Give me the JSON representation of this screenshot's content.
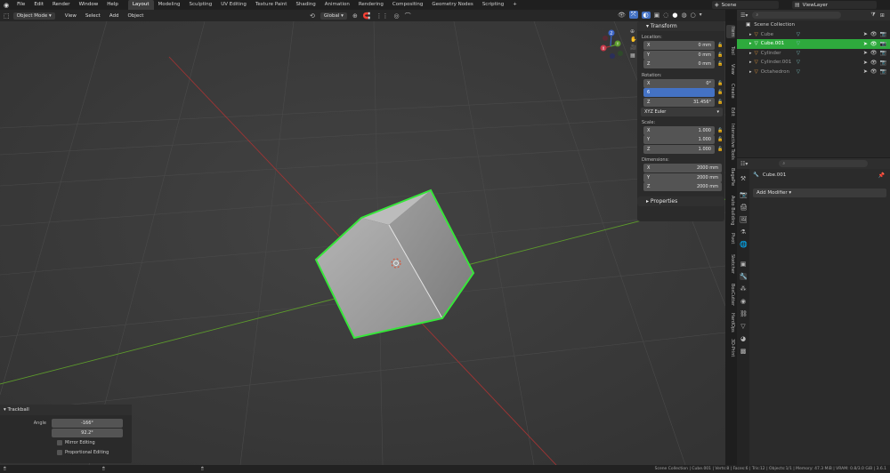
{
  "topbar": {
    "menus": [
      "File",
      "Edit",
      "Render",
      "Window",
      "Help"
    ],
    "workspaces": [
      "Layout",
      "Modeling",
      "Sculpting",
      "UV Editing",
      "Texture Paint",
      "Shading",
      "Animation",
      "Rendering",
      "Compositing",
      "Geometry Nodes",
      "Scripting"
    ],
    "add_tab": "+",
    "scene_label": "Scene",
    "viewlayer_label": "ViewLayer"
  },
  "viewport_header": {
    "mode": "Object Mode",
    "menus": [
      "View",
      "Select",
      "Add",
      "Object"
    ],
    "orientation": "Global"
  },
  "gizmo": {
    "x": "X",
    "y": "Y",
    "z": "Z"
  },
  "npanel": {
    "transform_title": "Transform",
    "location_label": "Location:",
    "location": [
      {
        "axis": "X",
        "value": "0 mm"
      },
      {
        "axis": "Y",
        "value": "0 mm"
      },
      {
        "axis": "Z",
        "value": "0 mm"
      }
    ],
    "rotation_label": "Rotation:",
    "rotation": [
      {
        "axis": "X",
        "value": "0°"
      },
      {
        "axis": "",
        "value": "6"
      },
      {
        "axis": "Z",
        "value": "31.456°"
      }
    ],
    "rotation_mode": "XYZ Euler",
    "scale_label": "Scale:",
    "scale": [
      {
        "axis": "X",
        "value": "1.000"
      },
      {
        "axis": "Y",
        "value": "1.000"
      },
      {
        "axis": "Z",
        "value": "1.000"
      }
    ],
    "dimensions_label": "Dimensions:",
    "dimensions": [
      {
        "axis": "X",
        "value": "2000 mm"
      },
      {
        "axis": "Y",
        "value": "2000 mm"
      },
      {
        "axis": "Z",
        "value": "2000 mm"
      }
    ],
    "properties_title": "Properties"
  },
  "sidebar_tabs": [
    "Item",
    "Tool",
    "View",
    "Create",
    "Edit",
    "Interactive Tools",
    "BagaPie",
    "Auto Building",
    "Pivot",
    "Sketcher",
    "BoxCutter",
    "HardOps",
    "3D-Print"
  ],
  "outliner": {
    "collection": "Scene Collection",
    "objects": [
      {
        "name": "Cube",
        "selected": false
      },
      {
        "name": "Cube.001",
        "selected": true
      },
      {
        "name": "Cylinder",
        "selected": false
      },
      {
        "name": "Cylinder.001",
        "selected": false
      },
      {
        "name": "Octahedron",
        "selected": false
      }
    ]
  },
  "properties": {
    "object_name": "Cube.001",
    "add_modifier": "Add Modifier"
  },
  "trackball": {
    "title": "Trackball",
    "angle_label": "Angle",
    "angle_values": [
      "-166°",
      "92.2°"
    ],
    "mirror_editing": "Mirror Editing",
    "proportional_editing": "Proportional Editing"
  },
  "status_bar": "Scene Collection | Cube.001 | Verts:8 | Faces:6 | Tris:12 | Objects:1/1 | Memory: 47.3 MiB | VRAM: 0.8/3.0 GiB | 3.6.1",
  "colors": {
    "selection_green": "#2eaa3d",
    "active_field": "#4472c4",
    "x_axis": "#a03434",
    "y_axis": "#5d9b2c"
  }
}
